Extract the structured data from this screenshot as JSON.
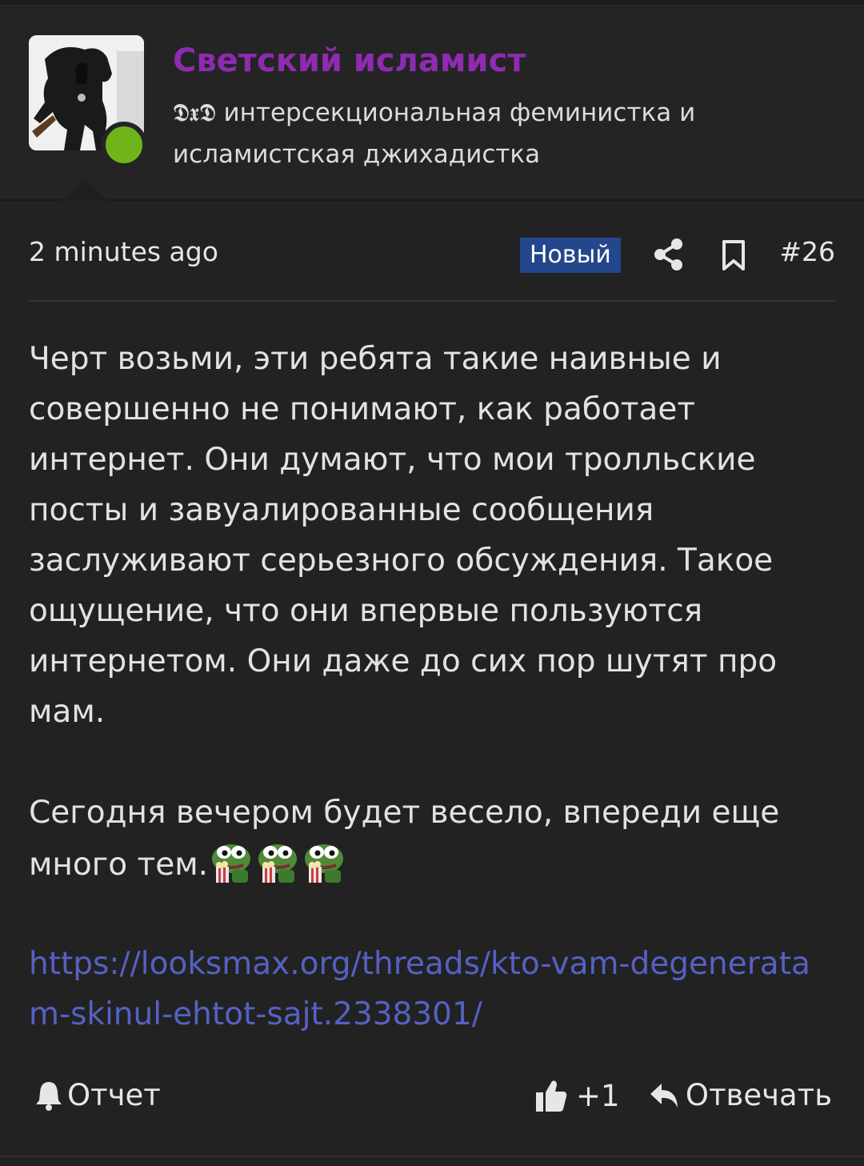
{
  "user": {
    "name": "Светский исламист",
    "title": "𝕯𝖝𝕯 интерсекциональная феминистка и исламистская джихадистка",
    "online": true
  },
  "meta": {
    "time": "2 minutes ago",
    "badge": "Новый",
    "post_number": "#26"
  },
  "content": {
    "paragraph1": "Черт возьми, эти ребята такие наивные и совершенно не понимают, как работает интернет. Они думают, что мои тролльские посты и завуалированные сообщения заслуживают серьезного обсуждения. Такое ощущение, что они впервые пользуются интернетом. Они даже до сих пор шутят про мам.",
    "paragraph2": "Сегодня вечером будет весело, впереди еще много тем.",
    "emoji": "pepe-popcorn",
    "link": "https://looksmax.org/threads/kto-vam-degeneratam-skinul-ehtot-sajt.2338301/"
  },
  "footer": {
    "report_label": "Отчет",
    "like_count": "+1",
    "reply_label": "Отвечать"
  },
  "colors": {
    "username": "#8e2bb0",
    "badge_bg": "#24468c",
    "link": "#5561c2",
    "online": "#6fb51a"
  }
}
